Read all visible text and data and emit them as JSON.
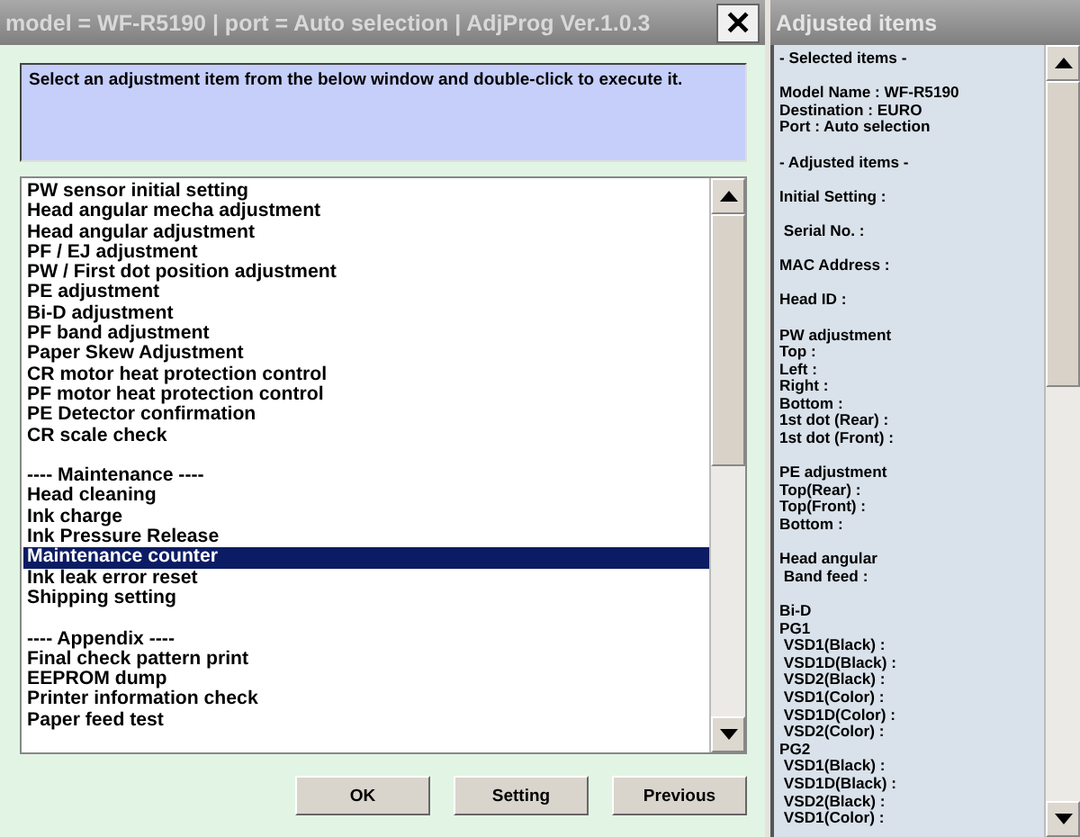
{
  "window": {
    "title": "model = WF-R5190 | port = Auto selection | AdjProg Ver.1.0.3",
    "close": "✕"
  },
  "instruction": "Select an adjustment item from the below window and double-click to execute it.",
  "list_groups": [
    [
      {
        "label": "PW sensor initial setting",
        "selected": false
      },
      {
        "label": "Head angular mecha adjustment",
        "selected": false
      },
      {
        "label": "Head angular adjustment",
        "selected": false
      },
      {
        "label": "PF / EJ adjustment",
        "selected": false
      },
      {
        "label": "PW / First dot position adjustment",
        "selected": false
      },
      {
        "label": "PE adjustment",
        "selected": false
      },
      {
        "label": "Bi-D adjustment",
        "selected": false
      },
      {
        "label": "PF band adjustment",
        "selected": false
      },
      {
        "label": "Paper Skew Adjustment",
        "selected": false
      },
      {
        "label": "CR motor heat protection control",
        "selected": false
      },
      {
        "label": "PF motor heat protection control",
        "selected": false
      },
      {
        "label": "PE Detector confirmation",
        "selected": false
      },
      {
        "label": "CR scale check",
        "selected": false
      }
    ],
    [
      {
        "label": "---- Maintenance ----",
        "selected": false
      },
      {
        "label": "Head cleaning",
        "selected": false
      },
      {
        "label": "Ink charge",
        "selected": false
      },
      {
        "label": "Ink Pressure Release",
        "selected": false
      },
      {
        "label": "Maintenance counter",
        "selected": true
      },
      {
        "label": "Ink leak error reset",
        "selected": false
      },
      {
        "label": "Shipping setting",
        "selected": false
      }
    ],
    [
      {
        "label": "---- Appendix ----",
        "selected": false
      },
      {
        "label": "Final check pattern print",
        "selected": false
      },
      {
        "label": "EEPROM dump",
        "selected": false
      },
      {
        "label": "Printer information check",
        "selected": false
      },
      {
        "label": "Paper feed test",
        "selected": false
      }
    ]
  ],
  "buttons": [
    "OK",
    "Setting",
    "Previous"
  ],
  "side_panel": {
    "title": "Adjusted items",
    "groups": [
      [
        "- Selected items -"
      ],
      [
        "Model Name : WF-R5190",
        "Destination : EURO",
        "Port : Auto selection"
      ],
      [
        "- Adjusted items -"
      ],
      [
        "Initial Setting :"
      ],
      [
        " Serial No. :"
      ],
      [
        "MAC Address :"
      ],
      [
        "Head ID :"
      ],
      [
        "PW adjustment",
        "Top :",
        "Left :",
        "Right :",
        "Bottom :",
        "1st dot (Rear) :",
        "1st dot (Front) :"
      ],
      [
        "PE adjustment",
        "Top(Rear) :",
        "Top(Front) :",
        "Bottom :"
      ],
      [
        "Head angular",
        " Band feed :"
      ],
      [
        "Bi-D",
        "PG1",
        " VSD1(Black) :",
        " VSD1D(Black) :",
        " VSD2(Black) :",
        " VSD1(Color) :",
        " VSD1D(Color) :",
        " VSD2(Color) :",
        "PG2",
        " VSD1(Black) :",
        " VSD1D(Black) :",
        " VSD2(Black) :",
        " VSD1(Color) :"
      ]
    ]
  }
}
